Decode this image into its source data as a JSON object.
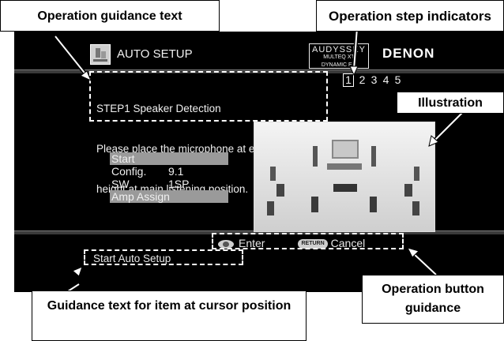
{
  "callouts": {
    "guidance": "Operation guidance text",
    "steps": "Operation step indicators",
    "illustration": "Illustration",
    "cursor_guidance": "Guidance text for item at cursor position",
    "button_guidance": "Operation button guidance"
  },
  "screen": {
    "title": "AUTO SETUP",
    "audyssey_line1": "AUDYSSEY",
    "audyssey_line2": "MULTEQ XT",
    "audyssey_line3": "DYNAMIC EQ",
    "brand": "DENON",
    "step_lines": [
      "STEP1 Speaker Detection",
      "Please place the microphone at ear",
      "height at main listening position."
    ],
    "steps": [
      "1",
      "2",
      "3",
      "4",
      "5"
    ],
    "menu": {
      "start": "Start",
      "config_label": "Config.",
      "config_value": "9.1",
      "sw_label": "SW",
      "sw_value": "1SP",
      "amp_assign": "Amp Assign"
    },
    "enter_label": "Enter",
    "return_badge": "RETURN",
    "cancel_label": "Cancel",
    "footer_text": "Start Auto Setup"
  },
  "icons": [
    "setup-icon",
    "enter-button-icon",
    "return-button-icon"
  ]
}
